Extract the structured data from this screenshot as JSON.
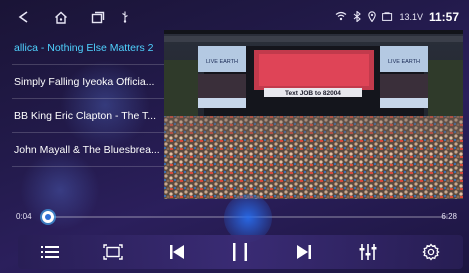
{
  "status": {
    "voltage": "13.1V",
    "time": "11:57"
  },
  "playlist": {
    "items": [
      {
        "label": "allica - Nothing Else Matters 2",
        "active": true
      },
      {
        "label": "Simply Falling  Iyeoka Officia...",
        "active": false
      },
      {
        "label": "BB King  Eric Clapton - The T...",
        "active": false
      },
      {
        "label": "John Mayall & The Bluesbrea...",
        "active": false
      }
    ]
  },
  "video": {
    "stage_banner": "Text JOB to 82004",
    "screen_text": "LIVE EARTH"
  },
  "progress": {
    "current": "0:04",
    "total": "6:28",
    "fraction": 0.01
  },
  "controls": [
    "list-icon",
    "aspect-icon",
    "previous-icon",
    "pause-icon",
    "next-icon",
    "equalizer-icon",
    "settings-icon"
  ],
  "colors": {
    "accent": "#4fd2ff",
    "progress": "#46b8ff",
    "background": "#221a4a"
  }
}
